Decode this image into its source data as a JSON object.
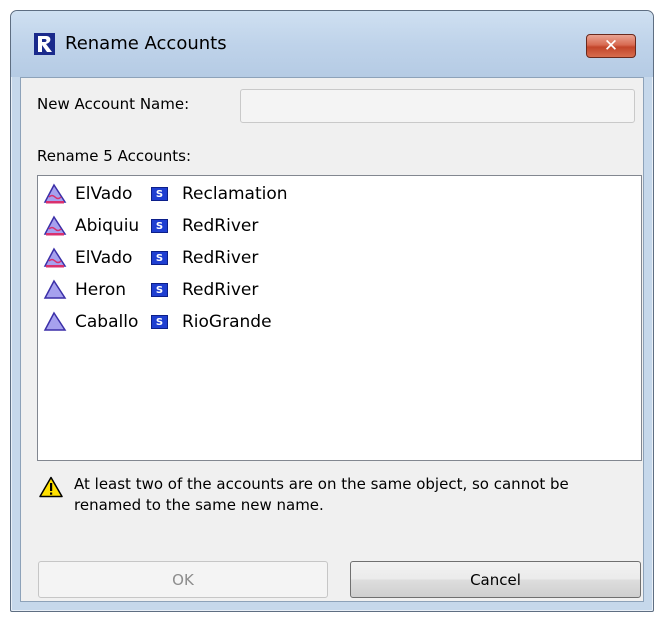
{
  "window": {
    "title": "Rename Accounts",
    "close_label": "✕",
    "app_icon": "riverware-r-icon"
  },
  "form": {
    "new_name_label": "New Account Name:",
    "new_name_value": "",
    "list_label": "Rename 5 Accounts:"
  },
  "accounts": [
    {
      "object": "ElVado",
      "object_icon": "reservoir-triangle-icon",
      "sub_icon": "S",
      "account": "Reclamation"
    },
    {
      "object": "Abiquiu",
      "object_icon": "reservoir-triangle-icon",
      "sub_icon": "S",
      "account": "RedRiver"
    },
    {
      "object": "ElVado",
      "object_icon": "reservoir-triangle-icon",
      "sub_icon": "S",
      "account": "RedRiver"
    },
    {
      "object": "Heron",
      "object_icon": "reservoir-triangle-icon",
      "sub_icon": "S",
      "account": "RedRiver"
    },
    {
      "object": "Caballo",
      "object_icon": "reservoir-triangle-icon",
      "sub_icon": "S",
      "account": "RioGrande"
    }
  ],
  "warning": {
    "icon": "warning-triangle-icon",
    "text": "At least two of the accounts are on the same object, so cannot be renamed to the same new name."
  },
  "buttons": {
    "ok_label": "OK",
    "cancel_label": "Cancel"
  },
  "colors": {
    "title_bar": "#c6d8eb",
    "close_button": "#c94a2f",
    "supplier_icon": "#1f3fd1",
    "warning": "#ffe000"
  }
}
